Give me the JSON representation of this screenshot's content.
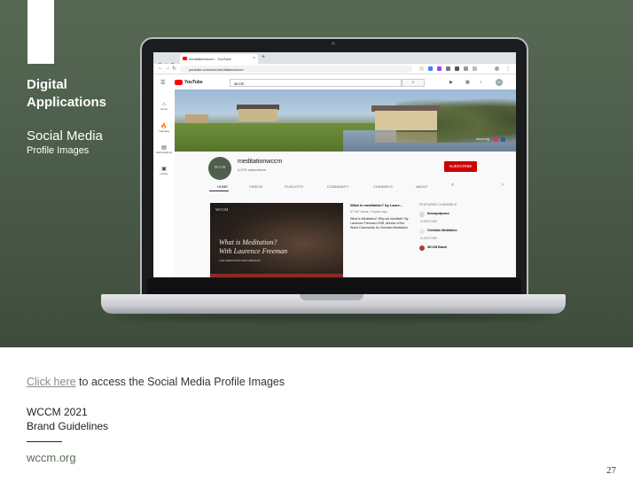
{
  "section": {
    "title_line1": "Digital",
    "title_line2": "Applications",
    "subtitle": "Social Media",
    "subtitle2": "Profile Images"
  },
  "browser": {
    "tab_title": "meditationwccm - YouTube",
    "tab_close": "×",
    "tab_new": "+",
    "url": "youtube.com/user/meditationwccm"
  },
  "youtube": {
    "logo_text": "YouTube",
    "search_value": "wccm",
    "sidebar": [
      {
        "icon": "⌂",
        "label": "Home"
      },
      {
        "icon": "🔥",
        "label": "Trending"
      },
      {
        "icon": "▤",
        "label": "Subscriptions"
      },
      {
        "icon": "▣",
        "label": "Library"
      }
    ],
    "channel_name": "meditationwccm",
    "subscribers": "4,97K subscribers",
    "avatar_text": "WCCM",
    "subscribe_label": "SUBSCRIBE",
    "tabs": [
      "HOME",
      "VIDEOS",
      "PLAYLISTS",
      "COMMUNITY",
      "CHANNELS",
      "ABOUT"
    ],
    "banner_link": "wccm.org",
    "video": {
      "logo": "WCCM",
      "title_line1": "What is Meditation?",
      "title_line2": "With Laurence Freeman",
      "subtitle": "LIVE MEDITATION RECORDINGS",
      "info_title": "What is meditation? by Laure...",
      "info_meta": "47,347 views • 5 years ago",
      "info_desc": "What is Meditation? Why we meditate? By Laurence Freeman OSB, director of the World Community for Christian Meditation"
    },
    "featured_title": "FEATURED CHANNELS",
    "featured": [
      {
        "name": "thewayofpeace",
        "sub": "SUBSCRIBE"
      },
      {
        "name": "Christian Meditation",
        "sub": "SUBSCRIBE"
      },
      {
        "name": "WCCM Brasil",
        "sub": ""
      }
    ]
  },
  "footer": {
    "link_text": "Click here",
    "link_rest": " to access the Social Media Profile Images",
    "brand_line1": "WCCM 2021",
    "brand_line2": "Brand Guidelines",
    "site": "wccm.org",
    "page_number": "27"
  },
  "colors": {
    "hero_green": "#576955",
    "youtube_red": "#cc0000",
    "site_green": "#5a6d57"
  }
}
